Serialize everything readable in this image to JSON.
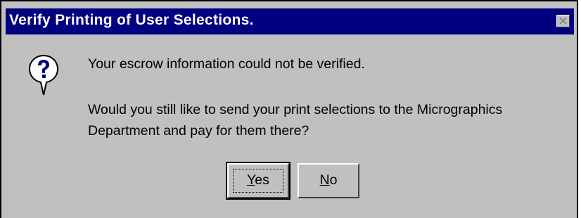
{
  "window": {
    "title": "Verify Printing of User Selections."
  },
  "message": {
    "line1": "Your escrow information could not be verified.",
    "line2": "Would you still like to send your print selections to the Micrographics",
    "line3": "Department and pay for them there?"
  },
  "buttons": {
    "yes": {
      "mnemonic": "Y",
      "rest": "es"
    },
    "no": {
      "mnemonic": "N",
      "rest": "o"
    }
  },
  "icons": {
    "dialog_icon": "question-icon",
    "close": "close-icon"
  },
  "colors": {
    "titlebar": "#000080",
    "face": "#c0c0c0",
    "icon_blue": "#000080"
  }
}
